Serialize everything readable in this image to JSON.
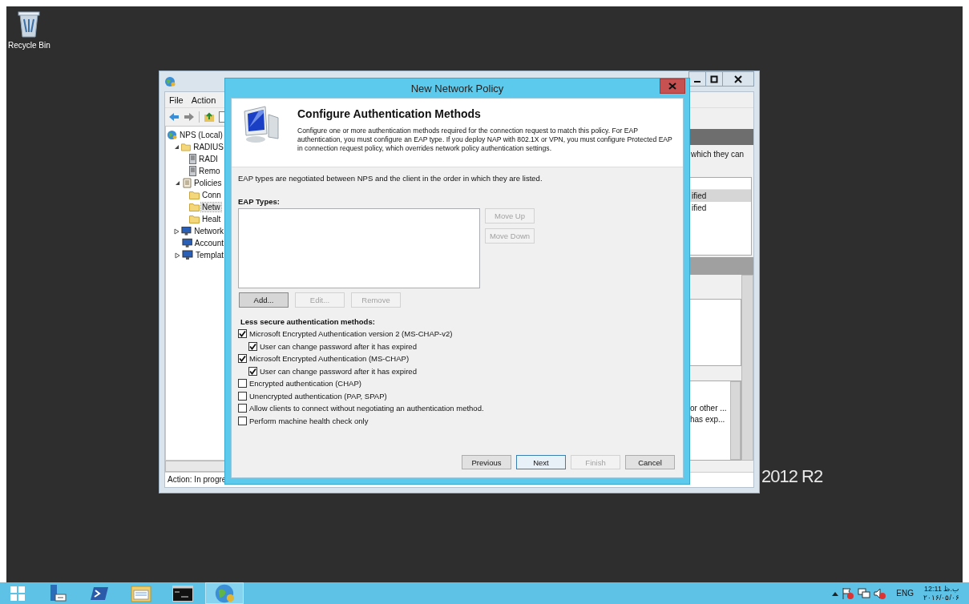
{
  "desktop": {
    "icons": [
      {
        "label": "Recycle Bin",
        "kind": "recycle-bin"
      }
    ],
    "branding": "2012 R2"
  },
  "mmc_window": {
    "menu": [
      "File",
      "Action"
    ],
    "tree": [
      {
        "label": "NPS (Local)",
        "kind": "globe",
        "selected": false,
        "children": [
          {
            "label": "RADIUS",
            "kind": "folder",
            "expanded": true,
            "selected": false,
            "children": [
              {
                "label": "RADI",
                "kind": "server",
                "selected": false
              },
              {
                "label": "Remo",
                "kind": "server",
                "selected": false
              }
            ]
          },
          {
            "label": "Policies",
            "kind": "scroll",
            "expanded": true,
            "selected": false,
            "children": [
              {
                "label": "Conn",
                "kind": "folder",
                "selected": false
              },
              {
                "label": "Netw",
                "kind": "folder",
                "selected": true
              },
              {
                "label": "Healt",
                "kind": "folder",
                "selected": false
              }
            ]
          },
          {
            "label": "Network",
            "kind": "monitor",
            "expanded": false,
            "selected": false
          },
          {
            "label": "Account",
            "kind": "monitor",
            "selected": false
          },
          {
            "label": "Templat",
            "kind": "monitor",
            "expanded": false,
            "selected": false
          }
        ]
      }
    ],
    "right_pane": {
      "description": "which they can",
      "list_rows": [
        {
          "text": "ified",
          "selected": true
        },
        {
          "text": "ified",
          "selected": false
        }
      ],
      "bottom_rows": [
        "or other ...",
        "has exp..."
      ]
    },
    "status": "Action:  In progre"
  },
  "dialog": {
    "title": "New Network Policy",
    "heading": "Configure Authentication Methods",
    "description": "Configure one or more authentication methods required for the connection request to match this policy. For EAP authentication, you must configure an EAP type. If you deploy NAP with 802.1X or VPN, you must configure Protected EAP in connection request policy, which overrides network policy authentication settings.",
    "note": "EAP types are negotiated between NPS and the client in the order in which they are listed.",
    "eap_label": "EAP Types:",
    "side_buttons": [
      {
        "label": "Move Up",
        "disabled": true
      },
      {
        "label": "Move Down",
        "disabled": true
      }
    ],
    "list_buttons": [
      {
        "label": "Add...",
        "disabled": false
      },
      {
        "label": "Edit...",
        "disabled": true
      },
      {
        "label": "Remove",
        "disabled": true
      }
    ],
    "less_secure_label": "Less secure authentication methods:",
    "options": [
      {
        "label": "Microsoft Encrypted Authentication version 2 (MS-CHAP-v2)",
        "checked": true,
        "children": [
          {
            "label": "User can change password after it has expired",
            "checked": true
          }
        ]
      },
      {
        "label": "Microsoft Encrypted Authentication (MS-CHAP)",
        "checked": true,
        "children": [
          {
            "label": "User can change password after it has expired",
            "checked": true
          }
        ]
      },
      {
        "label": "Encrypted authentication (CHAP)",
        "checked": false
      },
      {
        "label": "Unencrypted authentication (PAP, SPAP)",
        "checked": false
      },
      {
        "label": "Allow clients to connect without negotiating an authentication method.",
        "checked": false
      },
      {
        "label": "Perform machine health check only",
        "checked": false
      }
    ],
    "buttons": [
      {
        "label": "Previous",
        "disabled": false,
        "default": false
      },
      {
        "label": "Next",
        "disabled": false,
        "default": true
      },
      {
        "label": "Finish",
        "disabled": true,
        "default": false
      },
      {
        "label": "Cancel",
        "disabled": false,
        "default": false
      }
    ]
  },
  "taskbar": {
    "apps": [
      {
        "kind": "server-manager",
        "active": false
      },
      {
        "kind": "powershell",
        "active": false
      },
      {
        "kind": "explorer",
        "active": false
      },
      {
        "kind": "console",
        "active": false
      },
      {
        "kind": "globe",
        "active": true
      }
    ],
    "language": "ENG",
    "time": "12:11 ب.ظ",
    "date": "۲۰۱۶/۰۵/۰۶"
  }
}
